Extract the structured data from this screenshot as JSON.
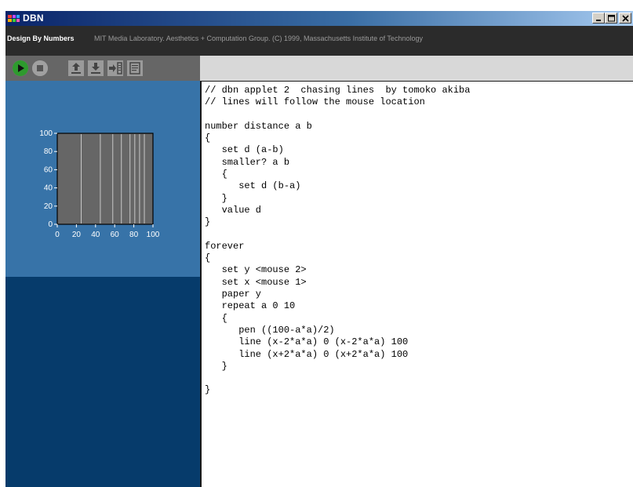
{
  "window": {
    "title": "DBN",
    "minimize_glyph": "minimize-icon",
    "maximize_glyph": "maximize-icon",
    "close_glyph": "close-icon"
  },
  "header": {
    "brand": "Design By Numbers",
    "credits": "MIT Media Laboratory. Aesthetics + Computation Group. (C) 1999, Massachusetts Institute of Technology"
  },
  "toolbar": {
    "buttons": [
      {
        "name": "run-button",
        "icon": "play-icon"
      },
      {
        "name": "stop-button",
        "icon": "stop-icon"
      },
      {
        "name": "open-button",
        "icon": "upload-icon"
      },
      {
        "name": "save-button",
        "icon": "download-icon"
      },
      {
        "name": "export-button",
        "icon": "export-icon"
      },
      {
        "name": "print-button",
        "icon": "print-icon"
      }
    ]
  },
  "preview": {
    "y_ticks": [
      "100",
      "80",
      "60",
      "40",
      "20",
      "0"
    ],
    "x_ticks": [
      "0",
      "20",
      "40",
      "60",
      "80",
      "100"
    ],
    "line_x_values": [
      25,
      45,
      58,
      67,
      76,
      81,
      86,
      91
    ]
  },
  "editor": {
    "code_lines": [
      "// dbn applet 2  chasing lines  by tomoko akiba",
      "// lines will follow the mouse location",
      "",
      "number distance a b",
      "{",
      "   set d (a-b)",
      "   smaller? a b",
      "   {",
      "      set d (b-a)",
      "   }",
      "   value d",
      "}",
      "",
      "forever",
      "{",
      "   set y <mouse 2>",
      "   set x <mouse 1>",
      "   paper y",
      "   repeat a 0 10",
      "   {",
      "      pen ((100-a*a)/2)",
      "      line (x-2*a*a) 0 (x-2*a*a) 100",
      "      line (x+2*a*a) 0 (x+2*a*a) 100",
      "   }",
      "",
      "}"
    ]
  },
  "colors": {
    "titlebar_start": "#0a246a",
    "header_bg": "#2b2b2b",
    "toolbar_bg": "#666666",
    "panel_dark": "#063b6b",
    "panel_light": "#3773a8",
    "canvas_bg": "#666666",
    "play_green": "#1e8a1e"
  }
}
